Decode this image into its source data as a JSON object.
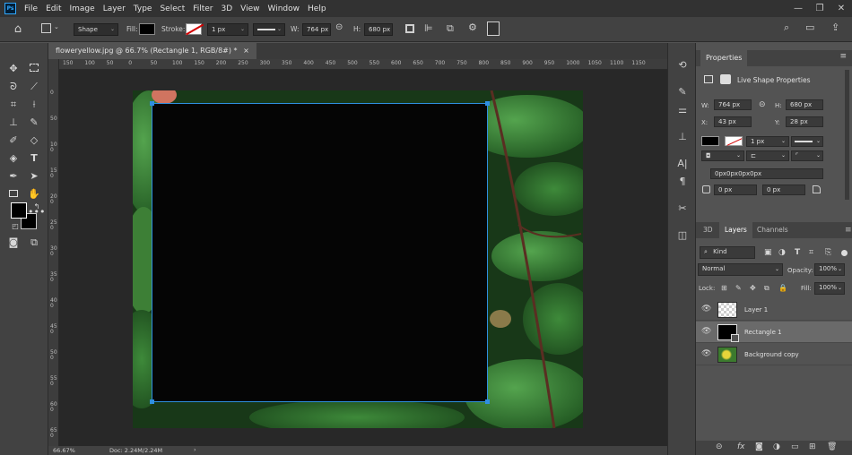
{
  "app": {
    "logo": "Ps"
  },
  "menu": [
    "File",
    "Edit",
    "Image",
    "Layer",
    "Type",
    "Select",
    "Filter",
    "3D",
    "View",
    "Window",
    "Help"
  ],
  "window_controls": {
    "minimize": "—",
    "maximize": "❐",
    "close": "✕"
  },
  "options": {
    "mode": "Shape",
    "fill_label": "Fill:",
    "stroke_label": "Stroke:",
    "stroke_width": "1 px",
    "w_label": "W:",
    "w_value": "764 px",
    "h_label": "H:",
    "h_value": "680 px"
  },
  "document": {
    "tab_title": "floweryellow.jpg @ 66.7% (Rectangle 1, RGB/8#) *",
    "tab_close": "×",
    "zoom": "66.67%",
    "doc_size": "Doc: 2.24M/2.24M"
  },
  "ruler_h_ticks": [
    "150",
    "100",
    "50",
    "0",
    "50",
    "100",
    "150",
    "200",
    "250",
    "300",
    "350",
    "400",
    "450",
    "500",
    "550",
    "600",
    "650",
    "700",
    "750",
    "800",
    "850",
    "900",
    "950",
    "1000",
    "1050",
    "1100",
    "1150"
  ],
  "ruler_v_ticks": [
    "0",
    "50",
    "100",
    "150",
    "200",
    "250",
    "300",
    "350",
    "400",
    "450",
    "500",
    "550",
    "600",
    "650"
  ],
  "properties": {
    "tab": "Properties",
    "section": "Live Shape Properties",
    "w_label": "W:",
    "w_value": "764 px",
    "h_label": "H:",
    "h_value": "680 px",
    "x_label": "X:",
    "x_value": "43 px",
    "y_label": "Y:",
    "y_value": "28 px",
    "stroke_width": "1 px",
    "corners": "0px0px0px0px",
    "corner_a": "0 px",
    "corner_b": "0 px"
  },
  "layers": {
    "tabs": [
      "3D",
      "Layers",
      "Channels"
    ],
    "kind": "Kind",
    "blend": "Normal",
    "opacity_label": "Opacity:",
    "opacity": "100%",
    "lock_label": "Lock:",
    "fill_label": "Fill:",
    "fill": "100%",
    "items": [
      {
        "name": "Layer 1"
      },
      {
        "name": "Rectangle 1"
      },
      {
        "name": "Background copy"
      }
    ]
  },
  "colors": {
    "accent": "#2f8fe0",
    "selection_row": "#6a6a6a",
    "foreground": "#000000",
    "background": "#ffffff"
  }
}
